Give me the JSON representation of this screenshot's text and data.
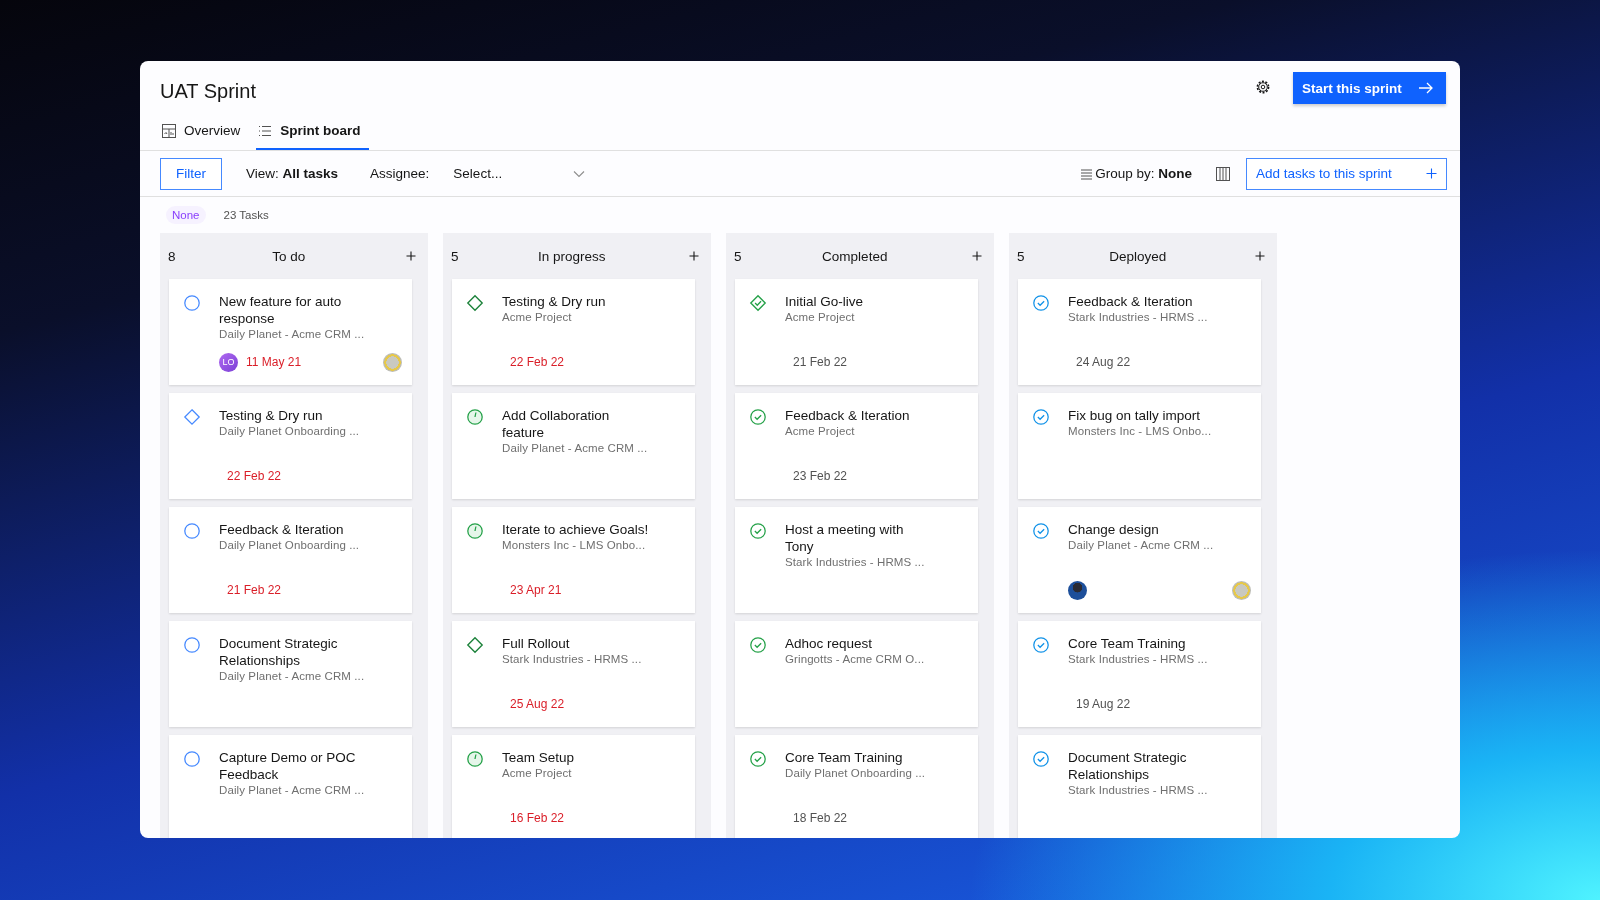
{
  "window": {
    "title": "UAT Sprint"
  },
  "header_button": {
    "label": "Start this sprint"
  },
  "tabs": [
    {
      "label": "Overview",
      "selected": false
    },
    {
      "label": "Sprint board",
      "selected": true
    }
  ],
  "toolbar": {
    "filter": "Filter",
    "view": "View: **All tasks**",
    "assignee_label": "Assignee:",
    "assignee_select": {
      "value": "Select..."
    },
    "group_by": "Group by: **None**",
    "add_button": "Add tasks to this sprint"
  },
  "summary": {
    "group_tag": "None",
    "task_count": "23 Tasks"
  },
  "columns": [
    {
      "count": "8",
      "title": "To do",
      "cards": [
        {
          "title": "New feature for auto response",
          "project": "Daily Planet - Acme CRM ...",
          "kind": "open",
          "date": "11 May 21",
          "overdue": true,
          "assignee": {
            "kind": "initials",
            "text": "LO"
          },
          "follower": {
            "kind": "photo"
          }
        },
        {
          "title": "Testing & Dry run",
          "project": "Daily Planet Onboarding ...",
          "kind": "milestone-open",
          "date": "22 Feb 22",
          "overdue": true
        },
        {
          "title": "Feedback & Iteration",
          "project": "Daily Planet Onboarding ...",
          "kind": "open",
          "date": "21 Feb 22",
          "overdue": true
        },
        {
          "title": "Document Strategic Relationships",
          "project": "Daily Planet - Acme CRM ...",
          "kind": "open"
        },
        {
          "title": "Capture Demo or POC Feedback",
          "project": "Daily Planet - Acme CRM ...",
          "kind": "open"
        }
      ]
    },
    {
      "count": "5",
      "title": "In progress",
      "cards": [
        {
          "title": "Testing & Dry run",
          "project": "Acme Project",
          "kind": "milestone",
          "date": "22 Feb 22",
          "overdue": true
        },
        {
          "title": "Add Collaboration feature",
          "project": "Daily Planet - Acme CRM ...",
          "kind": "progress"
        },
        {
          "title": "Iterate to achieve Goals!",
          "project": "Monsters Inc - LMS Onbo...",
          "kind": "progress",
          "date": "23 Apr 21",
          "overdue": true
        },
        {
          "title": "Full Rollout",
          "project": "Stark Industries - HRMS ...",
          "kind": "milestone",
          "date": "25 Aug 22",
          "overdue": true
        },
        {
          "title": "Team Setup",
          "project": "Acme Project",
          "kind": "progress",
          "date": "16 Feb 22",
          "overdue": true
        }
      ]
    },
    {
      "count": "5",
      "title": "Completed",
      "cards": [
        {
          "title": "Initial Go-live",
          "project": "Acme Project",
          "kind": "reached",
          "date": "21 Feb 22",
          "overdue": false
        },
        {
          "title": "Feedback & Iteration",
          "project": "Acme Project",
          "kind": "done",
          "date": "23 Feb 22",
          "overdue": false
        },
        {
          "title": "Host a meeting with Tony",
          "project": "Stark Industries - HRMS ...",
          "kind": "done"
        },
        {
          "title": "Adhoc request",
          "project": "Gringotts - Acme CRM O...",
          "kind": "done"
        },
        {
          "title": "Core Team Training",
          "project": "Daily Planet Onboarding ...",
          "kind": "done",
          "date": "18 Feb 22",
          "overdue": false
        }
      ]
    },
    {
      "count": "5",
      "title": "Deployed",
      "cards": [
        {
          "title": "Feedback & Iteration",
          "project": "Stark Industries - HRMS ...",
          "kind": "deployed",
          "date": "24 Aug 22",
          "overdue": false
        },
        {
          "title": "Fix bug on tally import",
          "project": "Monsters Inc - LMS Onbo...",
          "kind": "deployed"
        },
        {
          "title": "Change design",
          "project": "Daily Planet - Acme CRM ...",
          "kind": "deployed",
          "assignee": {
            "kind": "photo"
          },
          "follower": {
            "kind": "photo"
          }
        },
        {
          "title": "Core Team Training",
          "project": "Stark Industries - HRMS ...",
          "kind": "deployed",
          "date": "19 Aug 22",
          "overdue": false
        },
        {
          "title": "Document Strategic Relationships",
          "project": "Stark Industries - HRMS ...",
          "kind": "deployed"
        }
      ]
    }
  ]
}
